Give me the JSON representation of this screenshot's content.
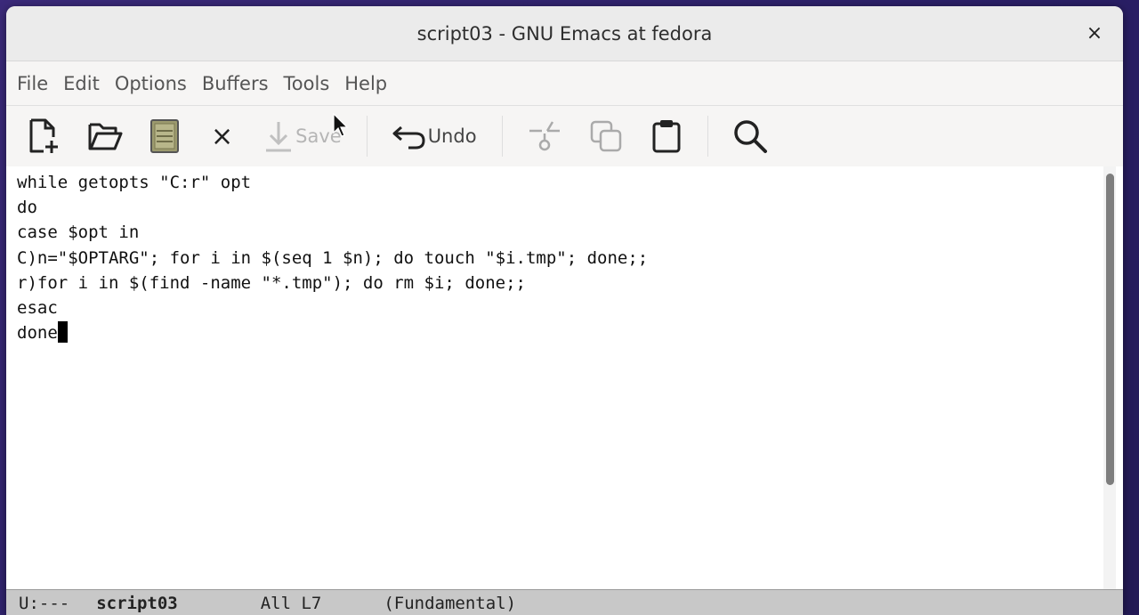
{
  "window": {
    "title": "script03 - GNU Emacs at fedora",
    "close_glyph": "×"
  },
  "menu": [
    "File",
    "Edit",
    "Options",
    "Buffers",
    "Tools",
    "Help"
  ],
  "toolbar": {
    "new_file_icon": "new-file-icon",
    "open_icon": "open-folder-icon",
    "dired_icon": "dired-icon",
    "kill_buffer_glyph": "×",
    "save_label": "Save",
    "undo_label": "Undo",
    "cut_icon": "scissors-icon",
    "copy_icon": "copy-icon",
    "paste_icon": "paste-icon",
    "search_icon": "search-icon"
  },
  "editor": {
    "lines": [
      "while getopts \"C:r\" opt",
      "do",
      "case $opt in",
      "C)n=\"$OPTARG\"; for i in $(seq 1 $n); do touch \"$i.tmp\"; done;;",
      "r)for i in $(find -name \"*.tmp\"); do rm $i; done;;",
      "esac",
      "done"
    ]
  },
  "modeline": {
    "status": "U:---",
    "buffer": "script03",
    "position": "All L7",
    "mode": "(Fundamental)"
  }
}
